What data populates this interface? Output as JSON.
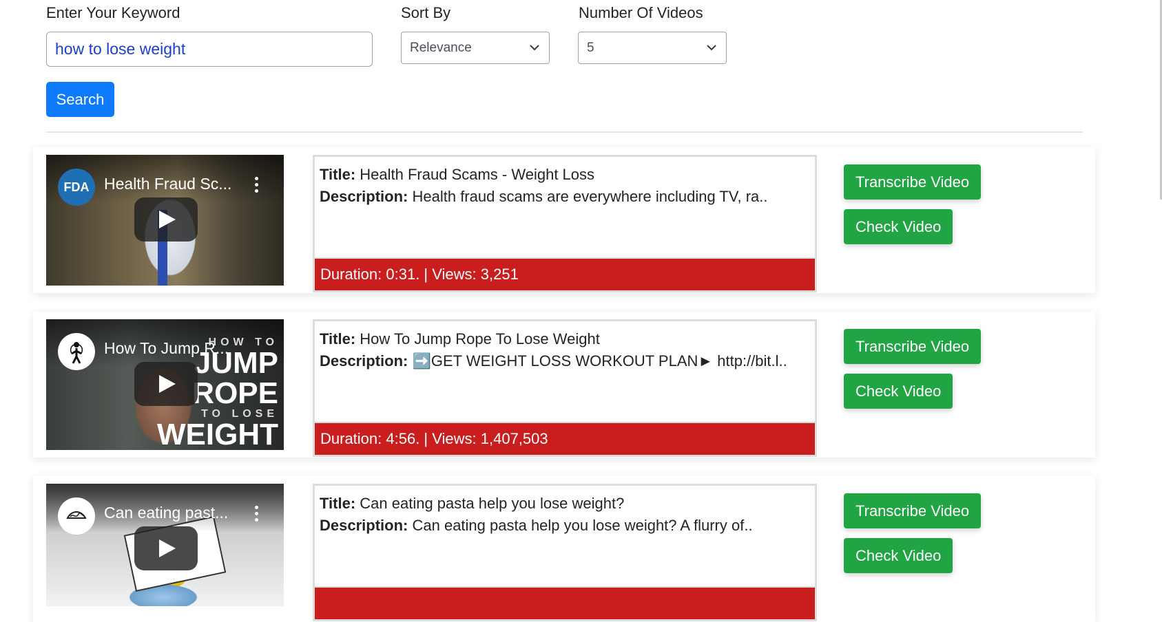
{
  "form": {
    "keyword_label": "Enter Your Keyword",
    "keyword_value": "how to lose weight",
    "sort_label": "Sort By",
    "sort_value": "Relevance",
    "count_label": "Number Of Videos",
    "count_value": "5",
    "search_label": "Search"
  },
  "labels": {
    "title": "Title:",
    "description": "Description:"
  },
  "buttons": {
    "transcribe": "Transcribe Video",
    "check": "Check Video"
  },
  "videos": [
    {
      "thumb_title": "Health Fraud Sc...",
      "channel_logo": "FDA",
      "title": "Health Fraud Scams - Weight Loss",
      "description": "Health fraud scams are everywhere including TV, ra..",
      "meta": "Duration: 0:31. | Views: 3,251"
    },
    {
      "thumb_title": "How To Jump R...",
      "channel_logo": "jump-rope-icon",
      "title": "How To Jump Rope To Lose Weight",
      "description": "➡️GET WEIGHT LOSS WORKOUT PLAN► http://bit.l..",
      "meta": "Duration: 4:56. | Views: 1,407,503"
    },
    {
      "thumb_title": "Can eating past...",
      "channel_logo": "pasta-icon",
      "title": "Can eating pasta help you lose weight?",
      "description": "Can eating pasta help you lose weight? A flurry of..",
      "meta": ""
    }
  ],
  "colors": {
    "primary": "#0d7bfc",
    "success": "#21a444",
    "danger": "#c91d1e"
  }
}
